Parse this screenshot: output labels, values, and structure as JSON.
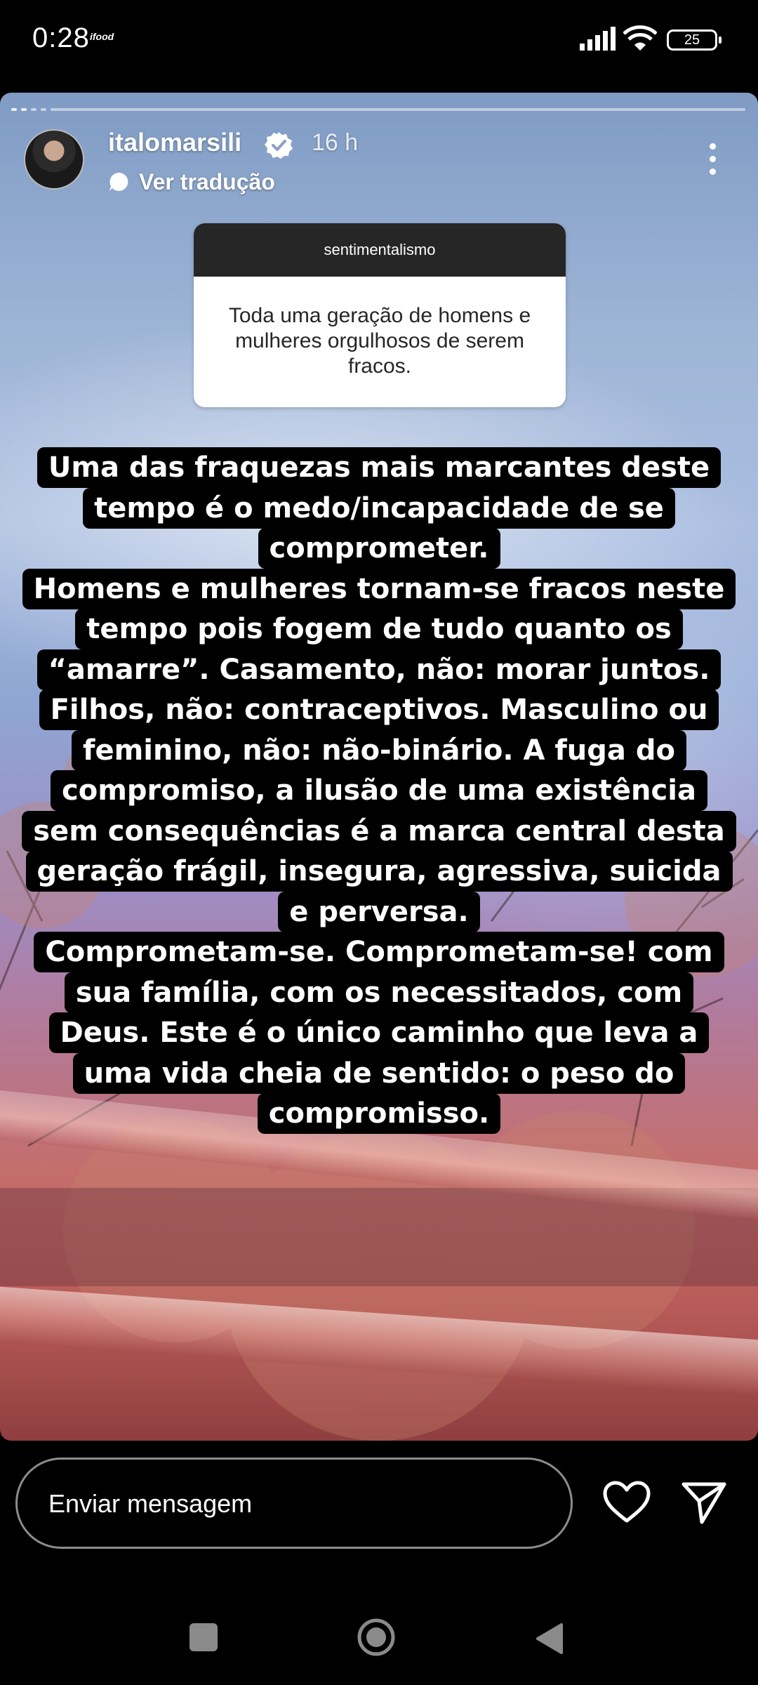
{
  "status_bar": {
    "time": "0:28",
    "app_label": "ifood",
    "battery": "25",
    "icons": [
      "signal-icon",
      "wifi-icon",
      "battery-icon"
    ]
  },
  "story": {
    "progress_segments": 5,
    "username": "italomarsili",
    "verified": true,
    "time_ago": "16 h",
    "translate_label": "Ver tradução",
    "question_sticker": {
      "title": "sentimentalismo",
      "answer": "Toda uma geração de homens e mulheres orgulhosos de serem fracos."
    },
    "caption": {
      "p1": "Uma das fraquezas mais marcantes deste tempo é o medo/incapacidade de se comprometer.",
      "p2": "Homens e mulheres tornam-se fracos neste tempo pois fogem de tudo quanto os “amarre”. Casamento, não: morar juntos. Filhos, não: contraceptivos. Masculino ou feminino, não: não-binário. A fuga do compromiso, a ilusão de uma existência sem consequências é a marca central desta geração frágil, insegura, agressiva, suicida e perversa.",
      "p3": "Comprometam-se. Comprometam-se! com sua família, com os necessitados, com Deus. Este é o único caminho que leva a uma vida cheia de sentido: o peso do compromisso."
    }
  },
  "footer": {
    "reply_placeholder": "Enviar mensagem",
    "icons": [
      "heart-icon",
      "send-icon"
    ]
  },
  "nav": {
    "icons": [
      "recents-icon",
      "home-icon",
      "back-icon"
    ]
  },
  "colors": {
    "sticker_header": "#262626",
    "caption_bg": "#000000",
    "verified_badge": "#ffffff"
  }
}
